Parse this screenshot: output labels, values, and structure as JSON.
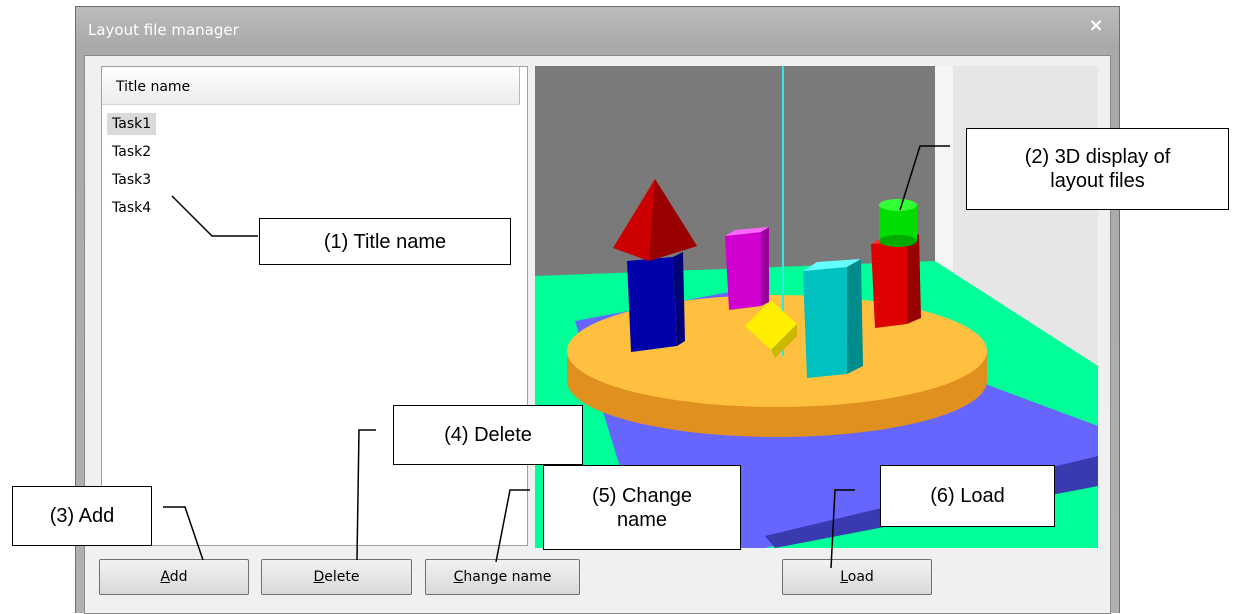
{
  "window": {
    "title": "Layout file manager",
    "close_glyph": "×"
  },
  "list": {
    "header": "Title name",
    "items": [
      "Task1",
      "Task2",
      "Task3",
      "Task4"
    ],
    "selected_index": 0
  },
  "buttons": {
    "add": {
      "accel": "A",
      "rest": "dd"
    },
    "delete": {
      "accel": "D",
      "rest": "elete"
    },
    "change_name": {
      "accel": "C",
      "rest": "hange name"
    },
    "load": {
      "accel": "L",
      "rest": "oad"
    }
  },
  "callouts": {
    "c1": "(1) Title name",
    "c2_line1": "(2) 3D display of",
    "c2_line2": "layout files",
    "c3": "(3) Add",
    "c4": "(4) Delete",
    "c5_line1": "(5) Change",
    "c5_line2": "name",
    "c6": "(6) Load"
  },
  "colors": {
    "wall": "#7a7a7a",
    "floor": "#00ff99",
    "table_top": "#ffc040",
    "base": "#6666ff",
    "accent_cyan": "#33e6e6"
  }
}
